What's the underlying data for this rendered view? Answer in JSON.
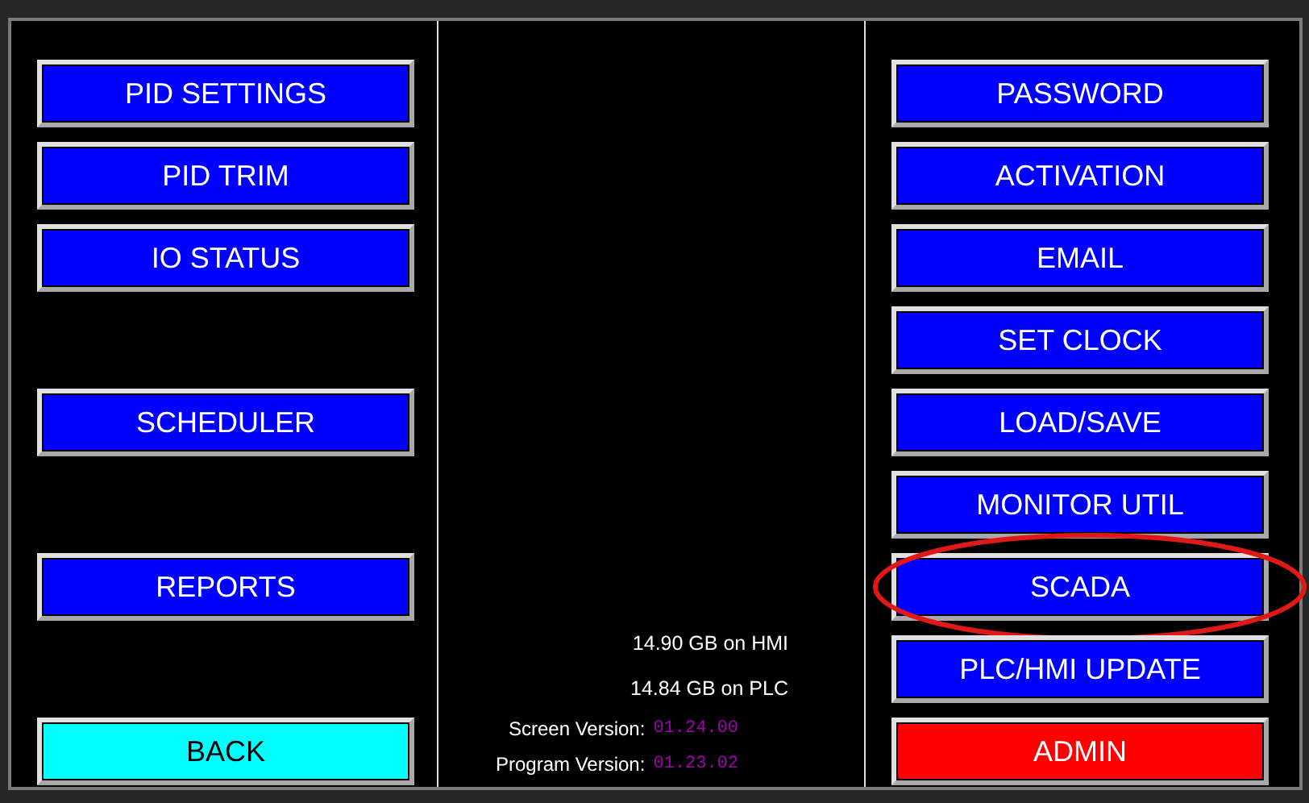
{
  "rows": [
    {
      "left": {
        "label": "PID SETTINGS",
        "color": "#0000ff"
      },
      "right": {
        "label": "PASSWORD",
        "color": "#0000ff",
        "highlighted": false
      }
    },
    {
      "left": {
        "label": "PID TRIM",
        "color": "#0000ff"
      },
      "right": {
        "label": "ACTIVATION",
        "color": "#0000ff",
        "highlighted": false
      }
    },
    {
      "left": {
        "label": "IO STATUS",
        "color": "#0000ff"
      },
      "right": {
        "label": "EMAIL",
        "color": "#0000ff",
        "highlighted": false
      }
    },
    {
      "left": null,
      "right": {
        "label": "SET CLOCK",
        "color": "#0000ff",
        "highlighted": false
      }
    },
    {
      "left": {
        "label": "SCHEDULER",
        "color": "#0000ff"
      },
      "right": {
        "label": "LOAD/SAVE",
        "color": "#0000ff",
        "highlighted": false
      }
    },
    {
      "left": null,
      "right": {
        "label": "MONITOR UTIL",
        "color": "#0000ff",
        "highlighted": false
      }
    },
    {
      "left": {
        "label": "REPORTS",
        "color": "#0000ff"
      },
      "right": {
        "label": "SCADA",
        "color": "#0000ff",
        "highlighted": true
      }
    },
    {
      "left": null,
      "right": {
        "label": "PLC/HMI UPDATE",
        "color": "#0000ff",
        "highlighted": false
      }
    },
    {
      "left": {
        "label": "BACK",
        "color": "#00ffff"
      },
      "right": {
        "label": "ADMIN",
        "color": "#ff0000",
        "highlighted": false
      }
    }
  ],
  "storage": [
    "14.90 GB on HMI",
    "14.84 GB on PLC"
  ],
  "versions": [
    {
      "label": "Screen Version:",
      "value": "01.24.00"
    },
    {
      "label": "Program Version:",
      "value": "01.23.02"
    }
  ]
}
